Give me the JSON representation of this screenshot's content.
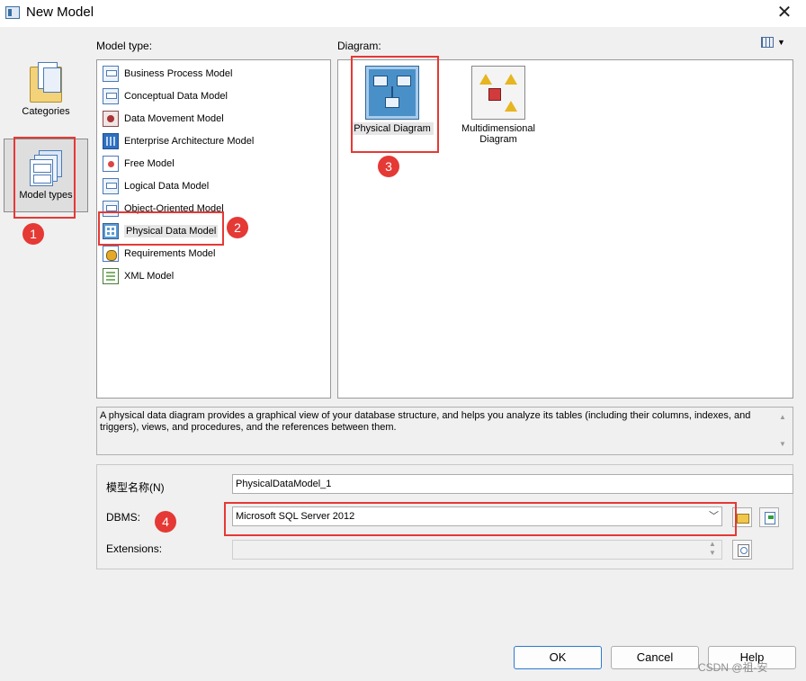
{
  "window": {
    "title": "New Model",
    "close_glyph": "✕"
  },
  "categories_rail": {
    "items": [
      {
        "label": "Categories",
        "icon": "folder-icon"
      },
      {
        "label": "Model types",
        "icon": "model-types-icon",
        "selected": true
      }
    ]
  },
  "model_type": {
    "label": "Model type:",
    "items": [
      {
        "label": "Business Process Model",
        "icon": "business-process-model-icon"
      },
      {
        "label": "Conceptual Data Model",
        "icon": "conceptual-data-model-icon"
      },
      {
        "label": "Data Movement Model",
        "icon": "data-movement-model-icon"
      },
      {
        "label": "Enterprise Architecture Model",
        "icon": "enterprise-architecture-model-icon"
      },
      {
        "label": "Free Model",
        "icon": "free-model-icon"
      },
      {
        "label": "Logical Data Model",
        "icon": "logical-data-model-icon"
      },
      {
        "label": "Object-Oriented Model",
        "icon": "object-oriented-model-icon"
      },
      {
        "label": "Physical Data Model",
        "icon": "physical-data-model-icon",
        "selected": true
      },
      {
        "label": "Requirements Model",
        "icon": "requirements-model-icon"
      },
      {
        "label": "XML Model",
        "icon": "xml-model-icon"
      }
    ]
  },
  "diagram": {
    "label": "Diagram:",
    "items": [
      {
        "label": "Physical Diagram",
        "icon": "physical-diagram-icon",
        "selected": true
      },
      {
        "label_line1": "Multidimensional",
        "label_line2": "Diagram",
        "icon": "multidimensional-diagram-icon"
      }
    ],
    "view_toggle_icon": "large-icons-view-icon"
  },
  "description": {
    "text": "A physical data diagram provides a graphical view of your database structure, and helps you analyze its tables (including their columns, indexes, and triggers), views, and procedures, and the references between them."
  },
  "form": {
    "model_name_label": "模型名称(N)",
    "model_name_value": "PhysicalDataModel_1",
    "dbms_label": "DBMS:",
    "dbms_value": "Microsoft SQL Server 2012",
    "extensions_label": "Extensions:",
    "extensions_value": ""
  },
  "buttons": {
    "ok": "OK",
    "cancel": "Cancel",
    "help": "Help"
  },
  "annotations": {
    "markers": [
      "1",
      "2",
      "3",
      "4"
    ],
    "color": "#e53935"
  },
  "watermark": "CSDN @祖-安",
  "colors": {
    "accent_blue": "#2a7ad2",
    "window_bg": "#f0f0f0",
    "annotation_red": "#e53935"
  }
}
